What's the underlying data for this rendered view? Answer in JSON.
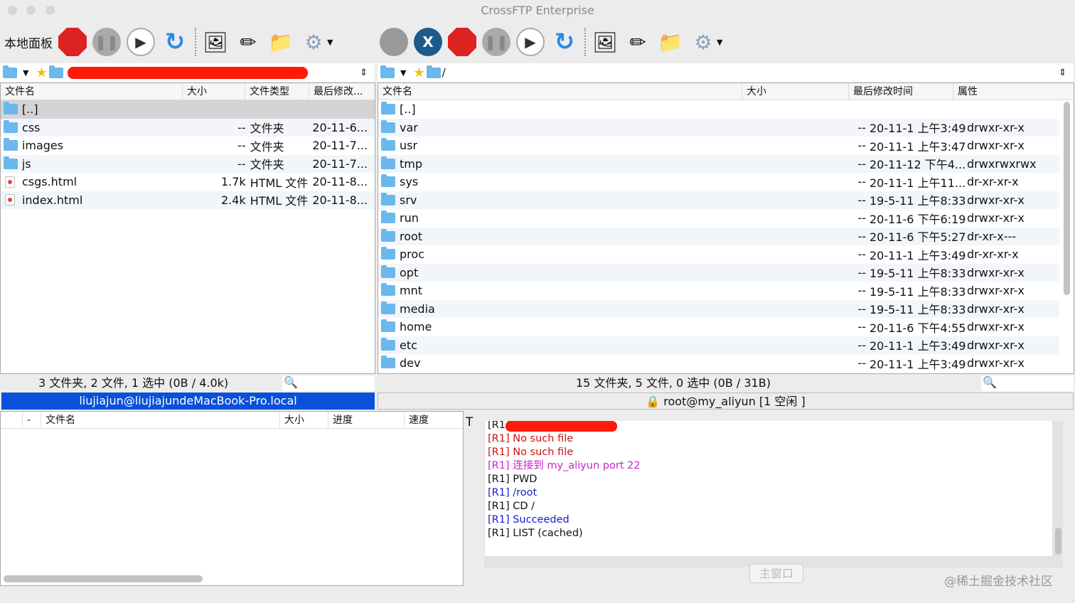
{
  "window": {
    "title": "CrossFTP Enterprise"
  },
  "local": {
    "panel_label": "本地面板",
    "columns": [
      "文件名",
      "大小",
      "文件类型",
      "最后修改..."
    ],
    "rows": [
      {
        "name": "[..]",
        "size": "",
        "type": "",
        "modified": "",
        "kind": "folder"
      },
      {
        "name": "css",
        "size": "--",
        "type": "文件夹",
        "modified": "20-11-6...",
        "kind": "folder"
      },
      {
        "name": "images",
        "size": "--",
        "type": "文件夹",
        "modified": "20-11-7...",
        "kind": "folder"
      },
      {
        "name": "js",
        "size": "--",
        "type": "文件夹",
        "modified": "20-11-7...",
        "kind": "folder"
      },
      {
        "name": "csgs.html",
        "size": "1.7k",
        "type": "HTML 文件",
        "modified": "20-11-8...",
        "kind": "file"
      },
      {
        "name": "index.html",
        "size": "2.4k",
        "type": "HTML 文件",
        "modified": "20-11-8...",
        "kind": "file"
      }
    ],
    "status": "3 文件夹, 2 文件, 1 选中 (0B / 4.0k)",
    "host": "liujiajun@liujiajundeMacBook-Pro.local"
  },
  "remote": {
    "path": "/",
    "columns": [
      "文件名",
      "大小",
      "最后修改时间",
      "属性"
    ],
    "rows": [
      {
        "name": "[..]",
        "size": "",
        "modified": "",
        "attr": ""
      },
      {
        "name": "var",
        "size": "--",
        "modified": "20-11-1 上午3:49",
        "attr": "drwxr-xr-x"
      },
      {
        "name": "usr",
        "size": "--",
        "modified": "20-11-1 上午3:47",
        "attr": "drwxr-xr-x"
      },
      {
        "name": "tmp",
        "size": "--",
        "modified": "20-11-12 下午4...",
        "attr": "drwxrwxrwx"
      },
      {
        "name": "sys",
        "size": "--",
        "modified": "20-11-1 上午11...",
        "attr": "dr-xr-xr-x"
      },
      {
        "name": "srv",
        "size": "--",
        "modified": "19-5-11 上午8:33",
        "attr": "drwxr-xr-x"
      },
      {
        "name": "run",
        "size": "--",
        "modified": "20-11-6 下午6:19",
        "attr": "drwxr-xr-x"
      },
      {
        "name": "root",
        "size": "--",
        "modified": "20-11-6 下午5:27",
        "attr": "dr-xr-x---"
      },
      {
        "name": "proc",
        "size": "--",
        "modified": "20-11-1 上午3:49",
        "attr": "dr-xr-xr-x"
      },
      {
        "name": "opt",
        "size": "--",
        "modified": "19-5-11 上午8:33",
        "attr": "drwxr-xr-x"
      },
      {
        "name": "mnt",
        "size": "--",
        "modified": "19-5-11 上午8:33",
        "attr": "drwxr-xr-x"
      },
      {
        "name": "media",
        "size": "--",
        "modified": "19-5-11 上午8:33",
        "attr": "drwxr-xr-x"
      },
      {
        "name": "home",
        "size": "--",
        "modified": "20-11-6 下午4:55",
        "attr": "drwxr-xr-x"
      },
      {
        "name": "etc",
        "size": "--",
        "modified": "20-11-1 上午3:49",
        "attr": "drwxr-xr-x"
      },
      {
        "name": "dev",
        "size": "--",
        "modified": "20-11-1 上午3:49",
        "attr": "drwxr-xr-x"
      }
    ],
    "status": "15 文件夹, 5 文件, 0 选中 (0B / 31B)",
    "host": "root@my_aliyun [1 空闲 ]"
  },
  "queue": {
    "columns": [
      "-",
      "文件名",
      "大小",
      "进度",
      "速度"
    ],
    "t_label": "T"
  },
  "log": [
    {
      "text": "[R1]",
      "color": "#111"
    },
    {
      "text": "[R1] No such file",
      "color": "#d01010"
    },
    {
      "text": "[R1] No such file",
      "color": "#d01010"
    },
    {
      "text": "[R1] 连接到 my_aliyun port 22",
      "color": "#cc22cc"
    },
    {
      "text": "[R1] PWD",
      "color": "#111"
    },
    {
      "text": "[R1] /root",
      "color": "#1a1acc"
    },
    {
      "text": "[R1] CD /",
      "color": "#111"
    },
    {
      "text": "[R1] Succeeded",
      "color": "#1a1acc"
    },
    {
      "text": "[R1] LIST (cached)",
      "color": "#111"
    }
  ],
  "main_window_button": "主窗口",
  "watermark": "@稀土掘金技术社区",
  "colors": {
    "selection": "#0a50d8",
    "redaction": "#ff1a0a"
  }
}
